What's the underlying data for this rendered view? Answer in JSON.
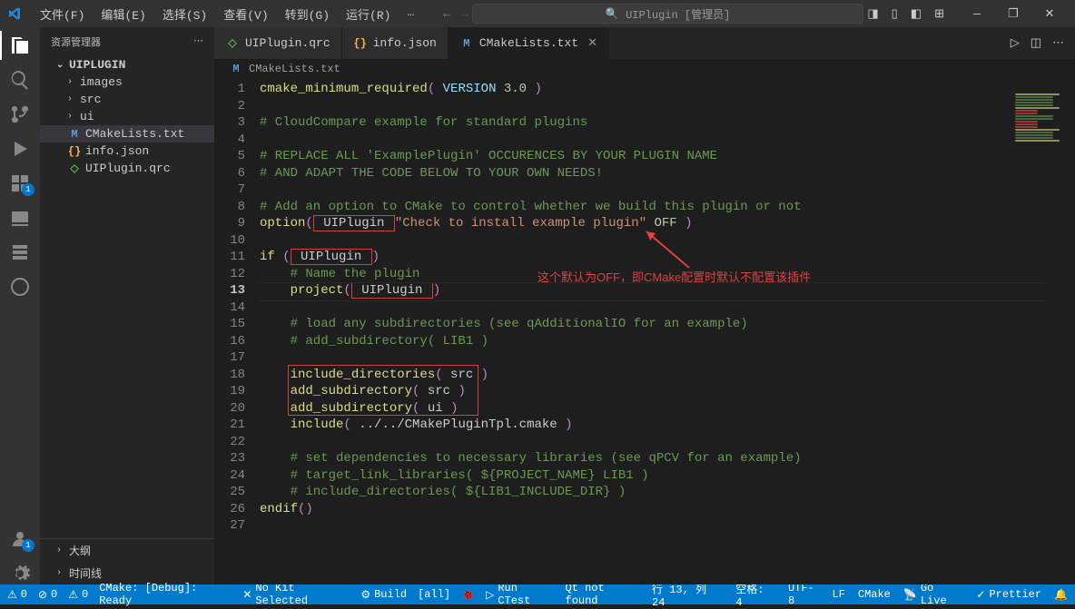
{
  "title": "UIPlugin [管理员]",
  "menu": [
    "文件(F)",
    "编辑(E)",
    "选择(S)",
    "查看(V)",
    "转到(G)",
    "运行(R)",
    "…"
  ],
  "sidebar": {
    "title": "资源管理器",
    "root": "UIPLUGIN",
    "items": [
      {
        "label": "images",
        "type": "folder"
      },
      {
        "label": "src",
        "type": "folder"
      },
      {
        "label": "ui",
        "type": "folder"
      },
      {
        "label": "CMakeLists.txt",
        "type": "cmake",
        "selected": true
      },
      {
        "label": "info.json",
        "type": "json"
      },
      {
        "label": "UIPlugin.qrc",
        "type": "qrc"
      }
    ],
    "sections": [
      "大纲",
      "时间线"
    ]
  },
  "tabs": [
    {
      "label": "UIPlugin.qrc",
      "icon": "qrc"
    },
    {
      "label": "info.json",
      "icon": "json"
    },
    {
      "label": "CMakeLists.txt",
      "icon": "cmake",
      "active": true
    }
  ],
  "breadcrumb": {
    "icon": "M",
    "file": "CMakeLists.txt"
  },
  "code": {
    "lines": [
      {
        "n": 1,
        "seg": [
          {
            "t": "cmake_minimum_required",
            "c": "fn"
          },
          {
            "t": "( ",
            "c": "par"
          },
          {
            "t": "VERSION ",
            "c": "var"
          },
          {
            "t": "3.0 ",
            "c": "num"
          },
          {
            "t": ")",
            "c": "par"
          }
        ]
      },
      {
        "n": 2,
        "seg": []
      },
      {
        "n": 3,
        "seg": [
          {
            "t": "# CloudCompare example for standard plugins",
            "c": "cmt"
          }
        ]
      },
      {
        "n": 4,
        "seg": []
      },
      {
        "n": 5,
        "seg": [
          {
            "t": "# REPLACE ALL 'ExamplePlugin' OCCURENCES BY YOUR PLUGIN NAME",
            "c": "cmt"
          }
        ]
      },
      {
        "n": 6,
        "seg": [
          {
            "t": "# AND ADAPT THE CODE BELOW TO YOUR OWN NEEDS!",
            "c": "cmt"
          }
        ]
      },
      {
        "n": 7,
        "seg": []
      },
      {
        "n": 8,
        "seg": [
          {
            "t": "# Add an option to CMake to control whether we build this plugin or not",
            "c": "cmt"
          }
        ]
      },
      {
        "n": 9,
        "seg": [
          {
            "t": "option",
            "c": "fn"
          },
          {
            "t": "(",
            "c": "par"
          },
          {
            "t": " UIPlugin ",
            "box": 1,
            "c": ""
          },
          {
            "t": "\"Check to install example plugin\" ",
            "c": "str"
          },
          {
            "t": "OFF ",
            "c": "num"
          },
          {
            "t": ")",
            "c": "par"
          }
        ]
      },
      {
        "n": 10,
        "seg": []
      },
      {
        "n": 11,
        "seg": [
          {
            "t": "if ",
            "c": "kw"
          },
          {
            "t": "(",
            "c": "par"
          },
          {
            "t": " UIPlugin ",
            "box": 1,
            "c": ""
          },
          {
            "t": ")",
            "c": "par"
          }
        ]
      },
      {
        "n": 12,
        "seg": [
          {
            "t": "    # Name the plugin",
            "c": "cmt"
          }
        ]
      },
      {
        "n": 13,
        "cur": true,
        "seg": [
          {
            "t": "    project",
            "c": "fn"
          },
          {
            "t": "(",
            "c": "par"
          },
          {
            "t": " UIPlugin ",
            "box": 1,
            "c": ""
          },
          {
            "t": ")",
            "c": "par"
          }
        ]
      },
      {
        "n": 14,
        "seg": []
      },
      {
        "n": 15,
        "seg": [
          {
            "t": "    # load any subdirectories (see qAdditionalIO for an example)",
            "c": "cmt"
          }
        ]
      },
      {
        "n": 16,
        "seg": [
          {
            "t": "    # add_subdirectory( LIB1 )",
            "c": "cmt"
          }
        ]
      },
      {
        "n": 17,
        "seg": []
      },
      {
        "n": 18,
        "box": 2,
        "seg": [
          {
            "t": "    include_directories",
            "c": "fn"
          },
          {
            "t": "( ",
            "c": "par"
          },
          {
            "t": "src ",
            "c": ""
          },
          {
            "t": ")",
            "c": "par"
          }
        ]
      },
      {
        "n": 19,
        "box": 2,
        "seg": [
          {
            "t": "    add_subdirectory",
            "c": "fn"
          },
          {
            "t": "( ",
            "c": "par"
          },
          {
            "t": "src ",
            "c": ""
          },
          {
            "t": ")",
            "c": "par"
          }
        ]
      },
      {
        "n": 20,
        "box": 2,
        "seg": [
          {
            "t": "    add_subdirectory",
            "c": "fn"
          },
          {
            "t": "( ",
            "c": "par"
          },
          {
            "t": "ui ",
            "c": ""
          },
          {
            "t": ")",
            "c": "par"
          }
        ]
      },
      {
        "n": 21,
        "seg": [
          {
            "t": "    include",
            "c": "fn"
          },
          {
            "t": "( ",
            "c": "par"
          },
          {
            "t": "../../CMakePluginTpl.cmake ",
            "c": ""
          },
          {
            "t": ")",
            "c": "par"
          }
        ]
      },
      {
        "n": 22,
        "seg": []
      },
      {
        "n": 23,
        "seg": [
          {
            "t": "    # set dependencies to necessary libraries (see qPCV for an example)",
            "c": "cmt"
          }
        ]
      },
      {
        "n": 24,
        "seg": [
          {
            "t": "    # target_link_libraries( ${PROJECT_NAME} LIB1 )",
            "c": "cmt"
          }
        ]
      },
      {
        "n": 25,
        "seg": [
          {
            "t": "    # include_directories( ${LIB1_INCLUDE_DIR} )",
            "c": "cmt"
          }
        ]
      },
      {
        "n": 26,
        "seg": [
          {
            "t": "endif",
            "c": "kw"
          },
          {
            "t": "()",
            "c": "par"
          }
        ]
      },
      {
        "n": 27,
        "seg": []
      }
    ]
  },
  "annotation": "这个默认为OFF，即CMake配置时默认不配置该插件",
  "statusbar": {
    "left": [
      {
        "icon": "⚠",
        "t": "0"
      },
      {
        "icon": "⊘",
        "t": "0"
      },
      {
        "icon": "⚠",
        "t": "0"
      },
      {
        "t": "CMake: [Debug]: Ready"
      },
      {
        "icon": "✕",
        "t": "No Kit Selected"
      },
      {
        "icon": "⚙",
        "t": "Build"
      },
      {
        "t": "[all]"
      },
      {
        "icon": "🐞",
        "t": ""
      },
      {
        "icon": "▷",
        "t": "Run CTest"
      },
      {
        "t": "Qt not found"
      }
    ],
    "right": [
      {
        "t": "行 13, 列 24"
      },
      {
        "t": "空格: 4"
      },
      {
        "t": "UTF-8"
      },
      {
        "t": "LF"
      },
      {
        "t": "CMake"
      },
      {
        "icon": "📡",
        "t": "Go Live"
      },
      {
        "icon": "✓",
        "t": "Prettier"
      },
      {
        "icon": "🔔",
        "t": ""
      }
    ]
  }
}
